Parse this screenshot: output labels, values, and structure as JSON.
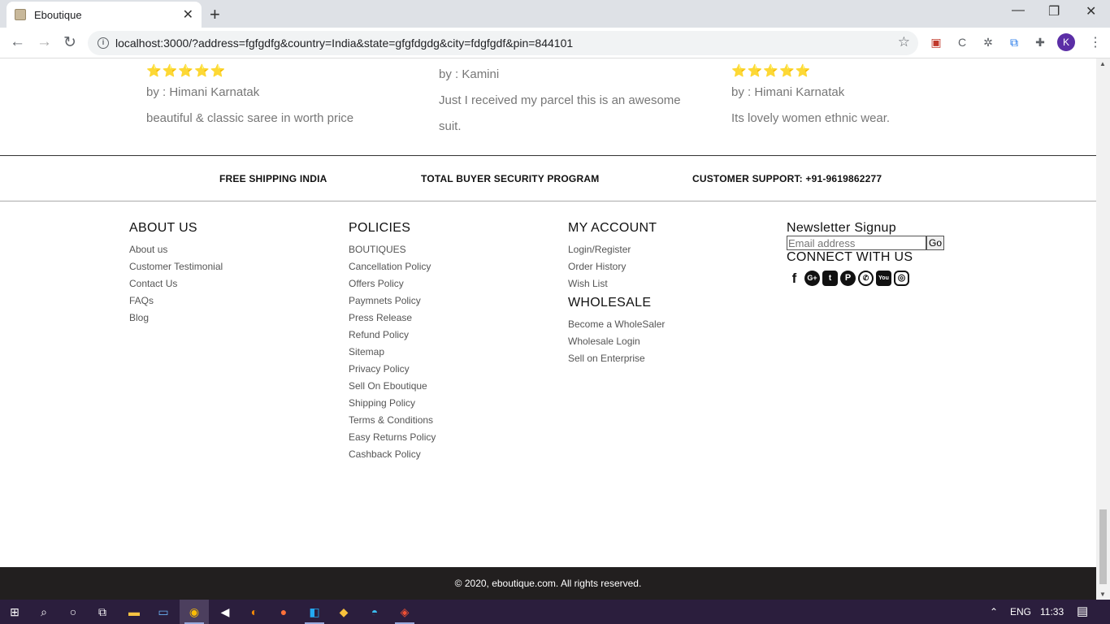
{
  "browser": {
    "tab_title": "Eboutique",
    "tab_close": "✕",
    "new_tab": "+",
    "url": "localhost:3000/?address=fgfgdfg&country=India&state=gfgfdgdg&city=fdgfgdf&pin=844101",
    "avatar_letter": "K"
  },
  "reviews": [
    {
      "stars": "⭐⭐⭐⭐⭐",
      "author": "by : Himani Karnatak",
      "text": "beautiful & classic saree in worth price"
    },
    {
      "author": "by : Kamini",
      "text": "Just I received my parcel this is an awesome suit."
    },
    {
      "stars": "⭐⭐⭐⭐⭐",
      "author": "by : Himani Karnatak",
      "text": "Its lovely women ethnic wear."
    }
  ],
  "features": {
    "shipping": "FREE SHIPPING INDIA",
    "security": "TOTAL BUYER SECURITY PROGRAM",
    "support": "CUSTOMER SUPPORT: +91-9619862277"
  },
  "about": {
    "title": "ABOUT US",
    "links": [
      "About us",
      "Customer Testimonial",
      "Contact Us",
      "FAQs",
      "Blog"
    ]
  },
  "policies": {
    "title": "POLICIES",
    "links": [
      "BOUTIQUES",
      "Cancellation Policy",
      "Offers Policy",
      "Paymnets Policy",
      "Press Release",
      "Refund Policy",
      "Sitemap",
      "Privacy Policy",
      "Sell On Eboutique",
      "Shipping Policy",
      "Terms & Conditions",
      "Easy Returns Policy",
      "Cashback Policy"
    ]
  },
  "account": {
    "title": "MY ACCOUNT",
    "links": [
      "Login/Register",
      "Order History",
      "Wish List"
    ],
    "wholesale_title": "WHOLESALE",
    "wholesale_links": [
      "Become a WholeSaler",
      "Wholesale Login",
      "Sell on Enterprise"
    ]
  },
  "newsletter": {
    "title": "Newsletter Signup",
    "placeholder": "Email address",
    "button": "Go",
    "connect_title": "CONNECT WITH US",
    "social_icons": [
      "facebook-icon",
      "google-plus-icon",
      "twitter-icon",
      "pinterest-icon",
      "whatsapp-icon",
      "youtube-icon",
      "instagram-icon"
    ]
  },
  "footer": {
    "copyright": "© 2020, eboutique.com. All rights reserved."
  },
  "taskbar": {
    "language": "ENG",
    "time": "11:33"
  }
}
